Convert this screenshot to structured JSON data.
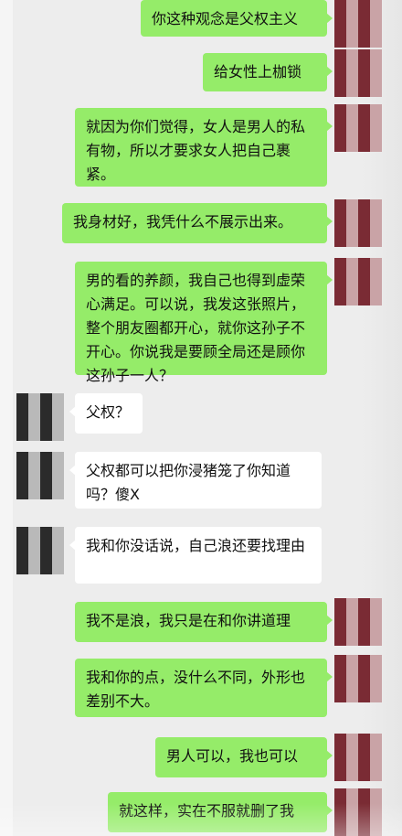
{
  "messages": [
    {
      "side": "sent",
      "text": "你这种观念是父权主义"
    },
    {
      "side": "sent",
      "text": "给女性上枷锁"
    },
    {
      "side": "sent",
      "text": "就因为你们觉得，女人是男人的私有物，所以才要求女人把自己裹紧。"
    },
    {
      "side": "sent",
      "text": "我身材好，我凭什么不展示出来。"
    },
    {
      "side": "sent",
      "text": "男的看的养颜，我自己也得到虚荣心满足。可以说，我发这张照片，整个朋友圈都开心，就你这孙子不开心。你说我是要顾全局还是顾你这孙子一人？"
    },
    {
      "side": "recv",
      "text": "父权？"
    },
    {
      "side": "recv",
      "text": "父权都可以把你浸猪笼了你知道吗？傻X"
    },
    {
      "side": "recv",
      "text": "我和你没话说，自己浪还要找理由"
    },
    {
      "side": "sent",
      "text": "我不是浪，我只是在和你讲道理"
    },
    {
      "side": "sent",
      "text": "我和你的点，没什么不同，外形也差别不大。"
    },
    {
      "side": "sent",
      "text": "男人可以，我也可以"
    },
    {
      "side": "sent",
      "text": "就这样，实在不服就删了我"
    }
  ],
  "avatars": {
    "self": "blurred-avatar-self",
    "other": "blurred-avatar-other"
  },
  "colors": {
    "background": "#ededed",
    "sent_bubble": "#95ec69",
    "recv_bubble": "#ffffff"
  }
}
